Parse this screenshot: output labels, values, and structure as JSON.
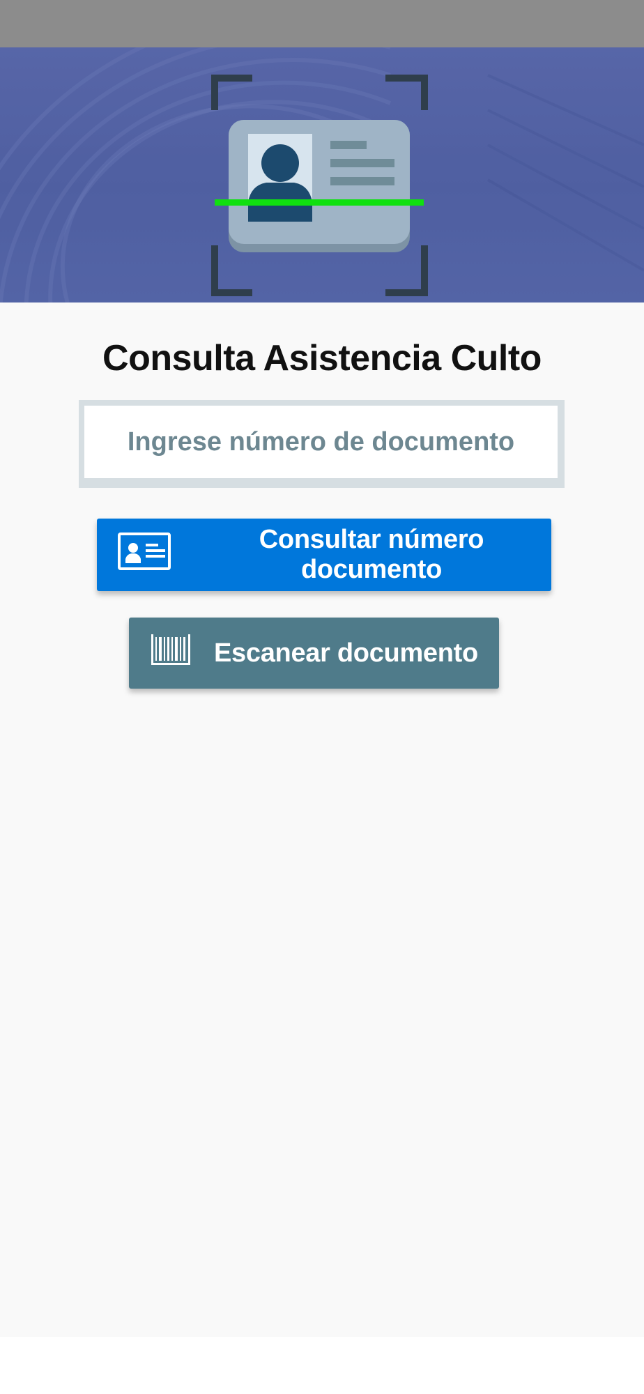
{
  "header": {
    "title": "Consulta Asistencia Culto"
  },
  "search": {
    "placeholder": "Ingrese número de documento",
    "value": ""
  },
  "actions": {
    "consult_label": "Consultar número documento",
    "consult_icon": "id-card-icon",
    "scan_label": "Escanear documento",
    "scan_icon": "barcode-icon"
  },
  "hero": {
    "illustration": "id-card-scan-icon"
  },
  "colors": {
    "status_bar": "#8c8c8c",
    "hero_blue": "#5563a5",
    "consult_button": "#0077db",
    "scan_button": "#4f7b8a",
    "scan_line": "#10e010",
    "placeholder": "#6d8791"
  }
}
